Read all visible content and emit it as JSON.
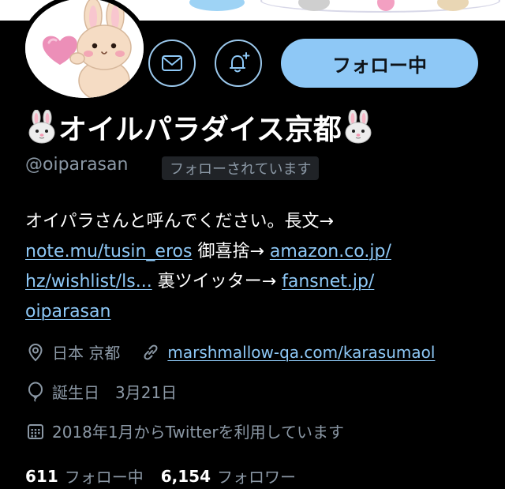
{
  "header_button": {
    "label": "フォロー中"
  },
  "profile": {
    "display_name": "オイルパラダイス京都",
    "handle": "@oiparasan",
    "follows_you_badge": "フォローされています"
  },
  "bio": {
    "line1": "オイパラさんと呼んでください。長文→",
    "link_note": "note.mu/tusin_eros",
    "text_wish": " 御喜捨→ ",
    "link_amazon_a": "amazon.co.jp/",
    "link_amazon_b": "hz/wishlist/ls...",
    "text_ura": " 裏ツイッター→ ",
    "link_fansnet_a": "fansnet.jp/",
    "link_fansnet_b": "oiparasan"
  },
  "meta": {
    "location": "日本 京都",
    "website": "marshmallow-qa.com/karasumaol",
    "birthday": "誕生日　3月21日",
    "joined": "2018年1月からTwitterを利用しています"
  },
  "counts": {
    "following_num": "611",
    "following_label": "フォロー中",
    "followers_num": "6,154",
    "followers_label": "フォロワー"
  },
  "colors": {
    "background": "#000000",
    "accent": "#8ec8f6",
    "secondary_text": "#8b98a5"
  },
  "icons": {
    "message": "envelope-icon",
    "notify": "bell-plus-icon",
    "location": "map-pin-icon",
    "website": "link-icon",
    "birthday": "balloon-icon",
    "joined": "calendar-icon"
  }
}
